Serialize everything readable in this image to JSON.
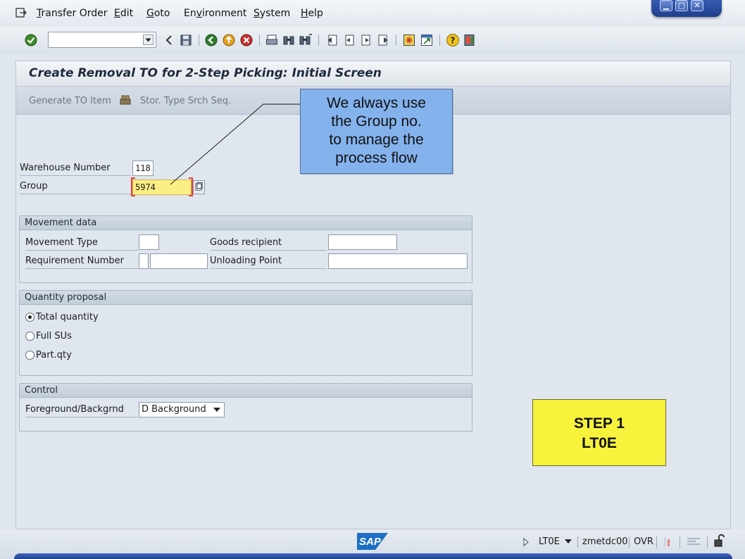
{
  "menubar": {
    "items": [
      {
        "u": "T",
        "rest": "ransfer Order"
      },
      {
        "u": "E",
        "rest": "dit"
      },
      {
        "u": "G",
        "rest": "oto"
      },
      {
        "pre": "En",
        "u": "v",
        "rest": "ironment"
      },
      {
        "u": "S",
        "rest": "ystem"
      },
      {
        "u": "H",
        "rest": "elp"
      }
    ]
  },
  "toolbar": {
    "command_field_value": "",
    "icons": [
      "enter-check-icon",
      "back-arrow-icon",
      "save-icon",
      "back-icon",
      "exit-icon",
      "cancel-icon",
      "print-icon",
      "find-icon",
      "find-next-icon",
      "first-page-icon",
      "previous-page-icon",
      "next-page-icon",
      "last-page-icon",
      "new-session-icon",
      "shortcut-icon",
      "help-icon",
      "layout-icon"
    ]
  },
  "screen": {
    "title": "Create Removal TO for 2-Step Picking: Initial Screen",
    "app_toolbar": {
      "generate_label": "Generate TO Item",
      "search_label": "Stor. Type Srch Seq."
    },
    "fields": {
      "warehouse_label": "Warehouse Number",
      "warehouse_value": "118",
      "group_label": "Group",
      "group_value": "5974"
    },
    "movement": {
      "title": "Movement data",
      "movement_type_label": "Movement Type",
      "movement_type_value": "",
      "requirement_label": "Requirement Number",
      "requirement_type_value": "",
      "requirement_value": "",
      "goods_recipient_label": "Goods recipient",
      "goods_recipient_value": "",
      "unloading_label": "Unloading Point",
      "unloading_value": ""
    },
    "quantity": {
      "title": "Quantity proposal",
      "options": [
        "Total quantity",
        "Full SUs",
        "Part.qty"
      ],
      "selected": 0
    },
    "control": {
      "title": "Control",
      "fg_label": "Foreground/Backgrnd",
      "fg_value": "D Background"
    }
  },
  "annotations": {
    "callout_lines": [
      "We always use",
      "the Group no.",
      "to manage the",
      "process flow"
    ],
    "step_lines": [
      "STEP 1",
      "LT0E"
    ]
  },
  "statusbar": {
    "logo_text": "SAP",
    "transaction": "LT0E",
    "server": "zmetdc00",
    "mode": "OVR"
  },
  "colors": {
    "focus_field": "#fbee84",
    "callout_bg": "#84b2ec",
    "step_bg": "#f7f23c"
  }
}
